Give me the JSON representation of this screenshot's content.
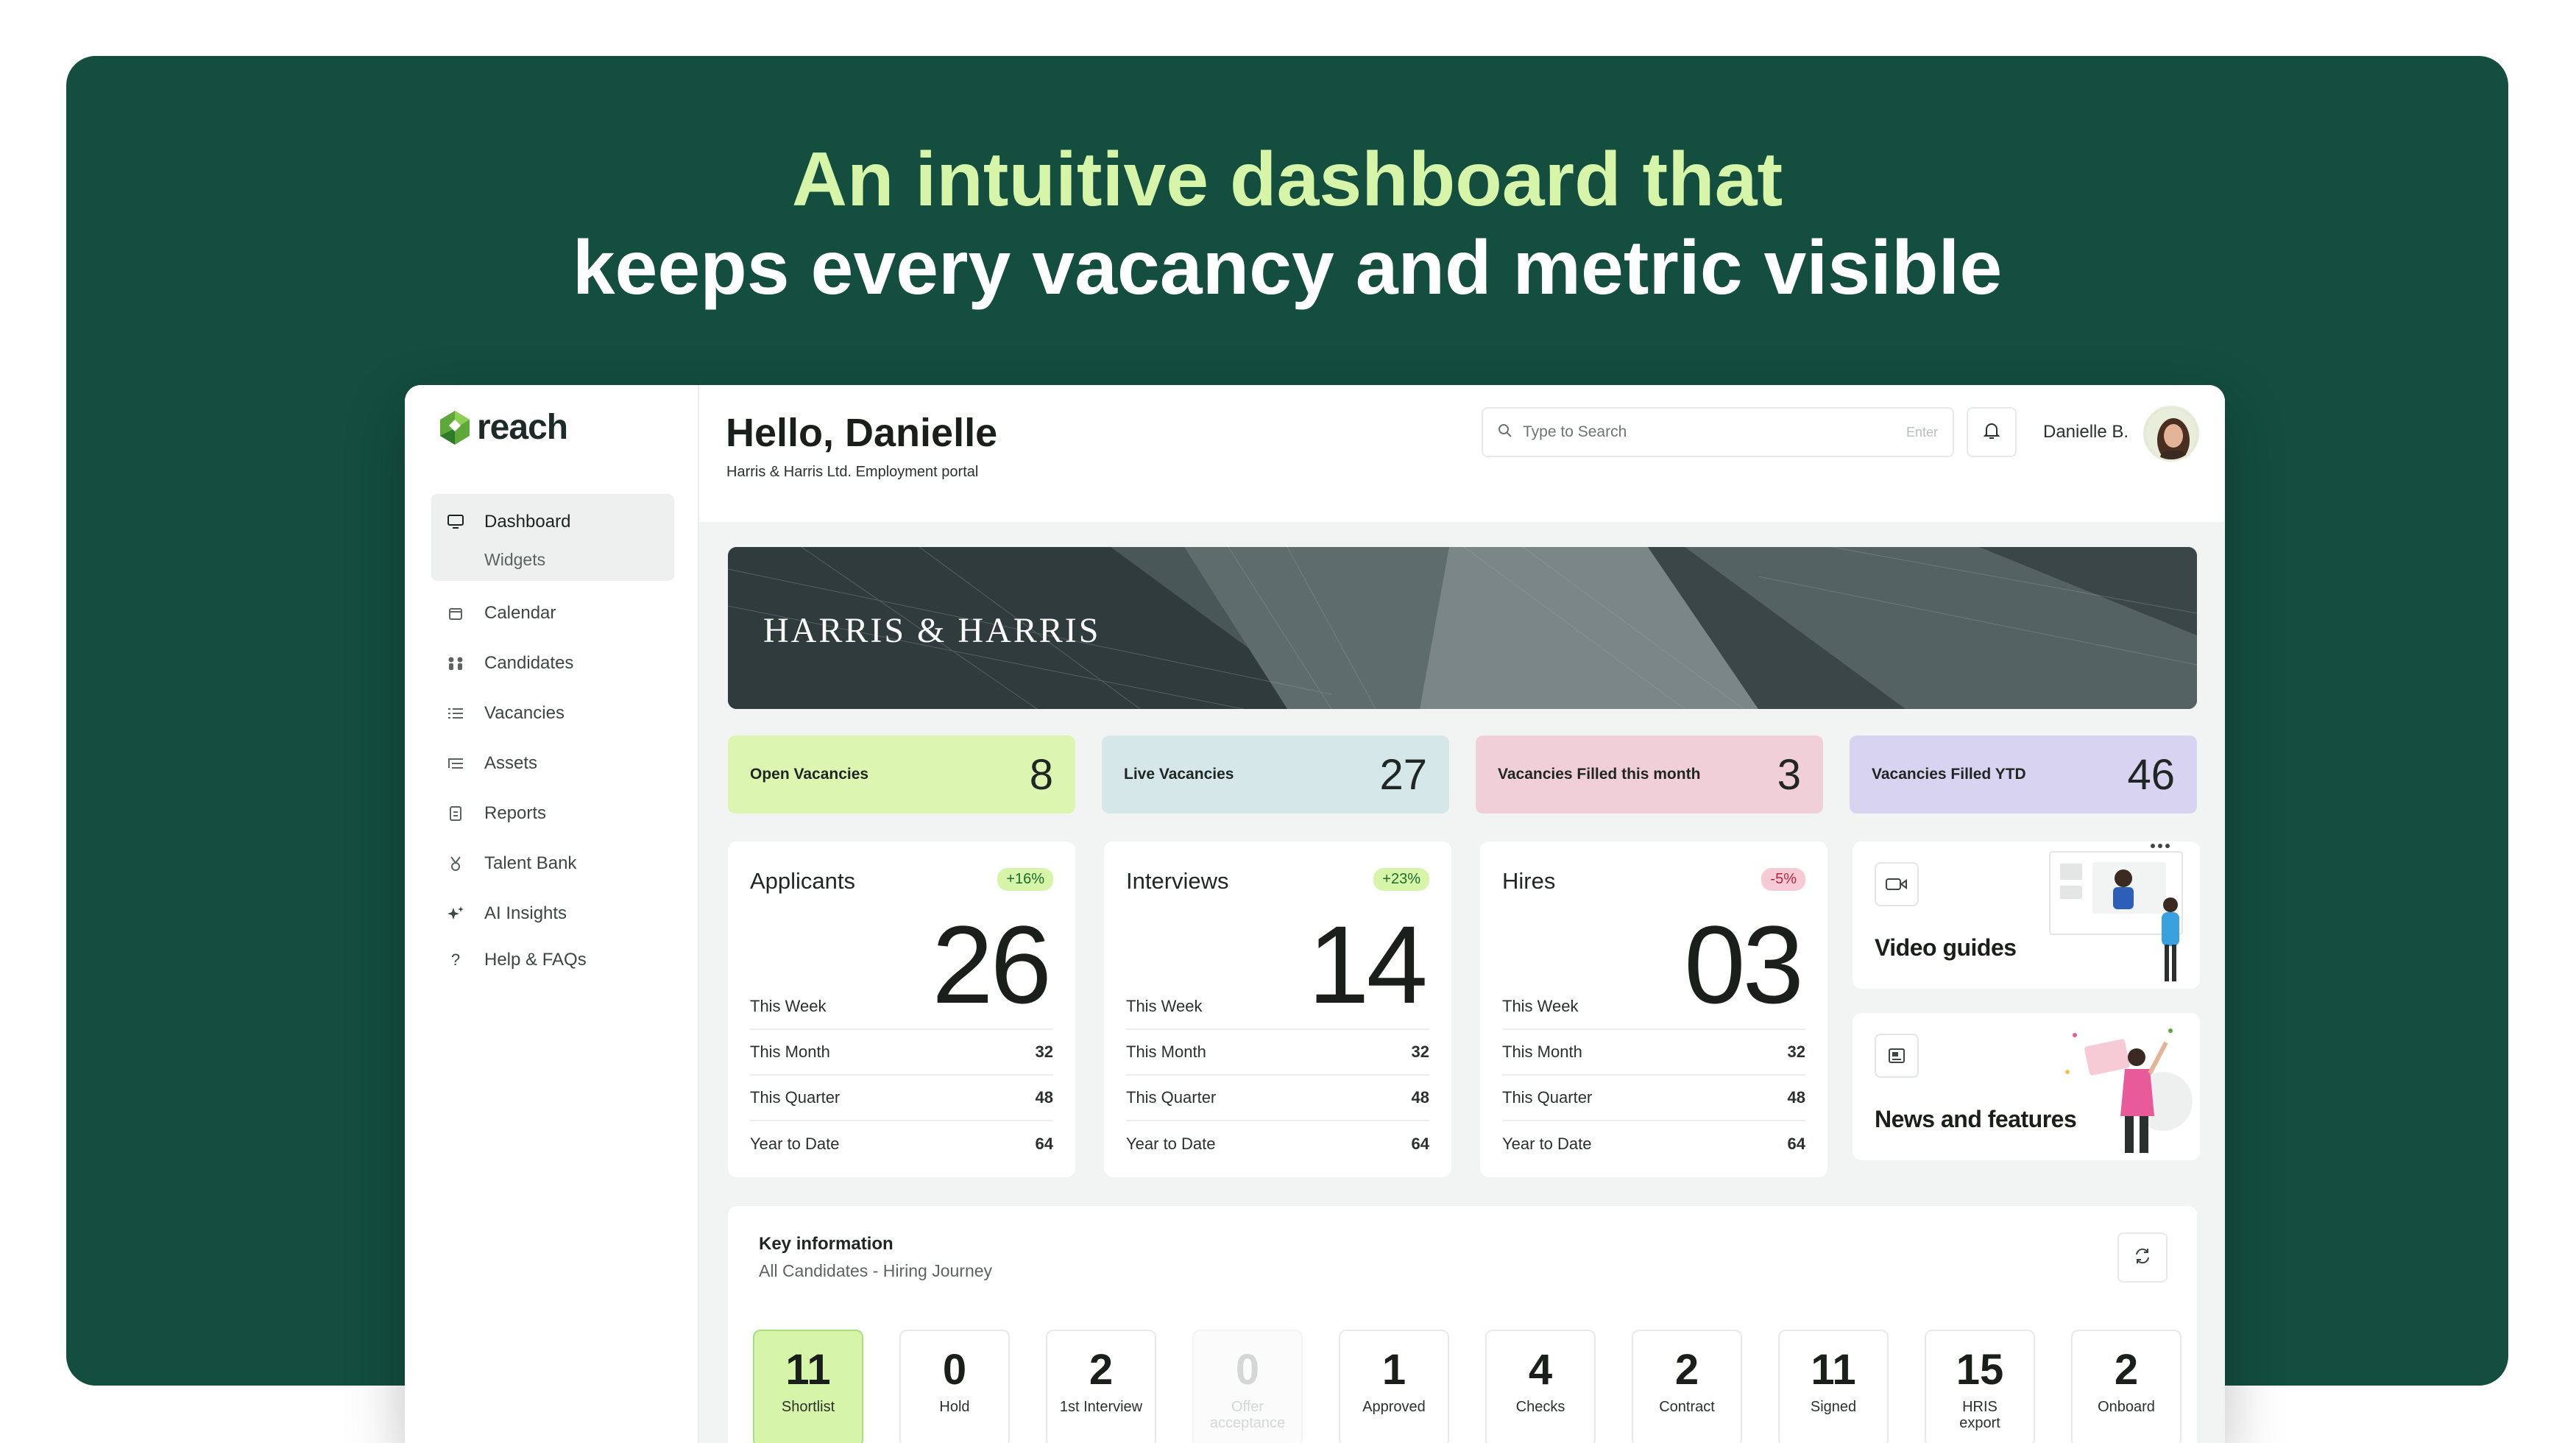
{
  "hero": {
    "line1": "An intuitive dashboard that",
    "line2": "keeps every vacancy and metric visible"
  },
  "brand": {
    "name": "reach",
    "accent": "#d7f5a8",
    "background": "#134e3e"
  },
  "sidebar": {
    "items": [
      {
        "label": "Dashboard",
        "icon": "monitor-icon"
      },
      {
        "label": "Widgets"
      },
      {
        "label": "Calendar",
        "icon": "calendar-icon"
      },
      {
        "label": "Candidates",
        "icon": "people-icon"
      },
      {
        "label": "Vacancies",
        "icon": "list-icon"
      },
      {
        "label": "Assets",
        "icon": "list-tree-icon"
      },
      {
        "label": "Reports",
        "icon": "document-icon"
      },
      {
        "label": "Talent Bank",
        "icon": "medal-icon"
      },
      {
        "label": "AI Insights",
        "icon": "sparkle-icon"
      },
      {
        "label": "Help & FAQs",
        "icon": "question-icon"
      }
    ]
  },
  "header": {
    "greeting": "Hello, Danielle",
    "subtitle": "Harris & Harris Ltd. Employment portal",
    "search_placeholder": "Type to Search",
    "search_hint": "Enter",
    "user_name": "Danielle B."
  },
  "banner": {
    "title": "HARRIS & HARRIS"
  },
  "tiles": [
    {
      "label": "Open Vacancies",
      "value": "8",
      "color": "#dcf5b0"
    },
    {
      "label": "Live Vacancies",
      "value": "27",
      "color": "#d6e7e9"
    },
    {
      "label": "Vacancies Filled this month",
      "value": "3",
      "color": "#f1cfd9"
    },
    {
      "label": "Vacancies Filled YTD",
      "value": "46",
      "color": "#d8d3f0"
    }
  ],
  "cards": [
    {
      "title": "Applicants",
      "badge": "+16%",
      "value": "26",
      "week_label": "This Week",
      "rows": [
        {
          "label": "This Month",
          "value": "32"
        },
        {
          "label": "This Quarter",
          "value": "48"
        },
        {
          "label": "Year to Date",
          "value": "64"
        }
      ]
    },
    {
      "title": "Interviews",
      "badge": "+23%",
      "value": "14",
      "week_label": "This Week",
      "rows": [
        {
          "label": "This Month",
          "value": "32"
        },
        {
          "label": "This Quarter",
          "value": "48"
        },
        {
          "label": "Year to Date",
          "value": "64"
        }
      ]
    },
    {
      "title": "Hires",
      "badge": "-5%",
      "value": "03",
      "week_label": "This Week",
      "rows": [
        {
          "label": "This Month",
          "value": "32"
        },
        {
          "label": "This Quarter",
          "value": "48"
        },
        {
          "label": "Year to Date",
          "value": "64"
        }
      ]
    }
  ],
  "side_cards": {
    "video": {
      "title": "Video guides",
      "icon": "video-icon"
    },
    "news": {
      "title": "News and features",
      "icon": "newspaper-icon"
    }
  },
  "key_info": {
    "title": "Key information",
    "subtitle": "All Candidates - Hiring Journey",
    "stages": [
      {
        "value": "11",
        "label": "Shortlist"
      },
      {
        "value": "0",
        "label": "Hold"
      },
      {
        "value": "2",
        "label": "1st Interview"
      },
      {
        "value": "0",
        "label": "Offer acceptance"
      },
      {
        "value": "1",
        "label": "Approved"
      },
      {
        "value": "4",
        "label": "Checks"
      },
      {
        "value": "2",
        "label": "Contract"
      },
      {
        "value": "11",
        "label": "Signed"
      },
      {
        "value": "15",
        "label": "HRIS export"
      },
      {
        "value": "2",
        "label": "Onboard"
      }
    ]
  }
}
